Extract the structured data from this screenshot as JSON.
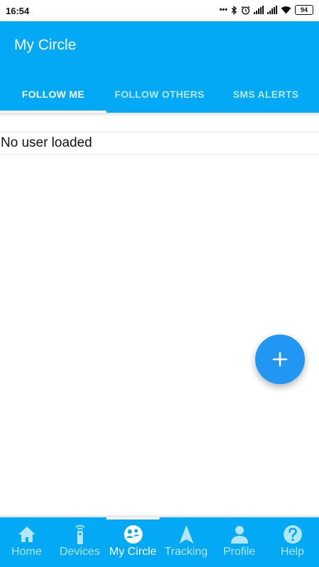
{
  "status_bar": {
    "time": "16:54",
    "battery": "94",
    "icons": [
      "dots-icon",
      "bluetooth-icon",
      "alarm-icon",
      "signal-icon",
      "signal-icon",
      "wifi-icon",
      "battery-icon"
    ]
  },
  "app_bar": {
    "title": "My Circle",
    "color": "#03A9F4",
    "tabs": [
      {
        "label": "FOLLOW ME",
        "active": true
      },
      {
        "label": "FOLLOW OTHERS",
        "active": false
      },
      {
        "label": "SMS ALERTS",
        "active": false
      }
    ]
  },
  "content": {
    "message": "No user loaded"
  },
  "fab": {
    "icon": "plus-icon",
    "color": "#2196F3"
  },
  "bottom_nav": {
    "items": [
      {
        "label": "Home",
        "icon": "home-icon",
        "active": false
      },
      {
        "label": "Devices",
        "icon": "devices-icon",
        "active": false
      },
      {
        "label": "My Circle",
        "icon": "circle-group-icon",
        "active": true
      },
      {
        "label": "Tracking",
        "icon": "navigation-arrow-icon",
        "active": false
      },
      {
        "label": "Profile",
        "icon": "person-icon",
        "active": false
      },
      {
        "label": "Help",
        "icon": "help-icon",
        "active": false
      }
    ]
  }
}
